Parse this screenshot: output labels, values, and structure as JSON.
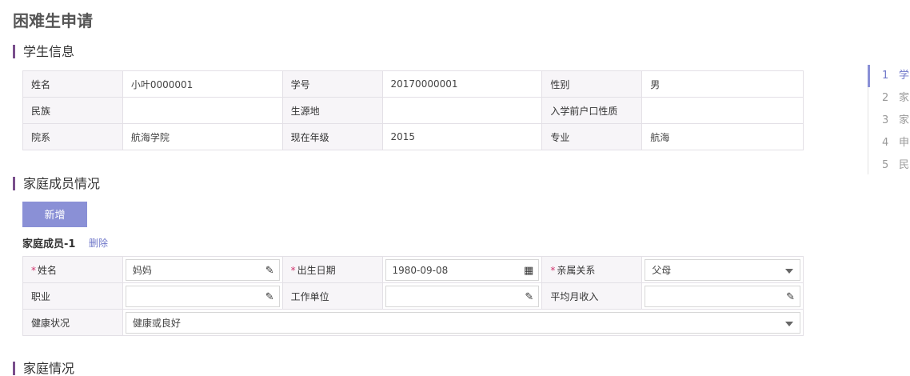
{
  "page_title": "困难生申请",
  "sections": {
    "student": "学生信息",
    "family_members": "家庭成员情况",
    "family_situation": "家庭情况"
  },
  "student_info": {
    "name_label": "姓名",
    "name": "小叶0000001",
    "id_label": "学号",
    "id": "20170000001",
    "gender_label": "性别",
    "gender": "男",
    "ethnicity_label": "民族",
    "ethnicity": "",
    "origin_label": "生源地",
    "origin": "",
    "hukou_label": "入学前户口性质",
    "hukou": "",
    "dept_label": "院系",
    "dept": "航海学院",
    "grade_label": "现在年级",
    "grade": "2015",
    "major_label": "专业",
    "major": "航海"
  },
  "actions": {
    "add_label": "新增",
    "delete_label": "删除"
  },
  "member": {
    "title": "家庭成员-1",
    "name_label": "姓名",
    "name": "妈妈",
    "birth_label": "出生日期",
    "birth": "1980-09-08",
    "relation_label": "亲属关系",
    "relation": "父母",
    "job_label": "职业",
    "job": "",
    "employer_label": "工作单位",
    "employer": "",
    "income_label": "平均月收入",
    "income": "",
    "health_label": "健康状况",
    "health": "健康或良好",
    "required_mark": "*"
  },
  "toc": [
    {
      "num": "1",
      "label": "学"
    },
    {
      "num": "2",
      "label": "家"
    },
    {
      "num": "3",
      "label": "家"
    },
    {
      "num": "4",
      "label": "申"
    },
    {
      "num": "5",
      "label": "民"
    }
  ],
  "icons": {
    "edit": "pencil-icon",
    "calendar": "calendar-icon",
    "dropdown": "chevron-down-icon"
  },
  "colors": {
    "accent": "#8a90d6",
    "link": "#6f77c9",
    "section_bar": "#7a4f8c",
    "required": "#d0336c"
  }
}
